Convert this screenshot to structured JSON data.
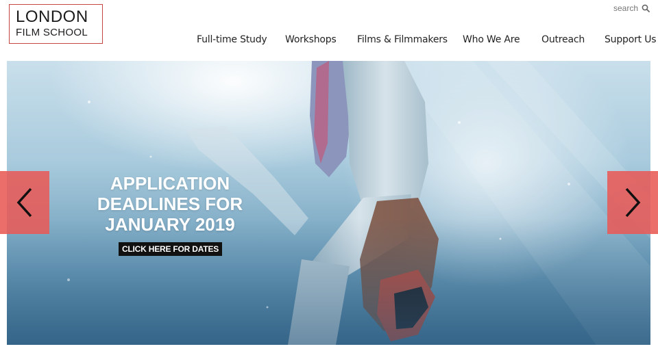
{
  "header": {
    "logo": {
      "line1": "LONDON",
      "line2": "FILM SCHOOL"
    },
    "search": {
      "label": "search",
      "icon": "search-icon"
    }
  },
  "nav": {
    "items": [
      {
        "label": "Full-time Study"
      },
      {
        "label": "Workshops"
      },
      {
        "label": "Films & Filmmakers"
      },
      {
        "label": "Who We Are"
      },
      {
        "label": "Outreach"
      },
      {
        "label": "Support Us"
      }
    ]
  },
  "hero": {
    "headline": "APPLICATION DEADLINES FOR JANUARY 2019",
    "cta_label": "CLICK HERE FOR DATES",
    "prev_icon": "chevron-left-icon",
    "next_icon": "chevron-right-icon"
  },
  "colors": {
    "accent": "#e85a56",
    "logo_border": "#c4443f",
    "cta_background": "#111111"
  }
}
